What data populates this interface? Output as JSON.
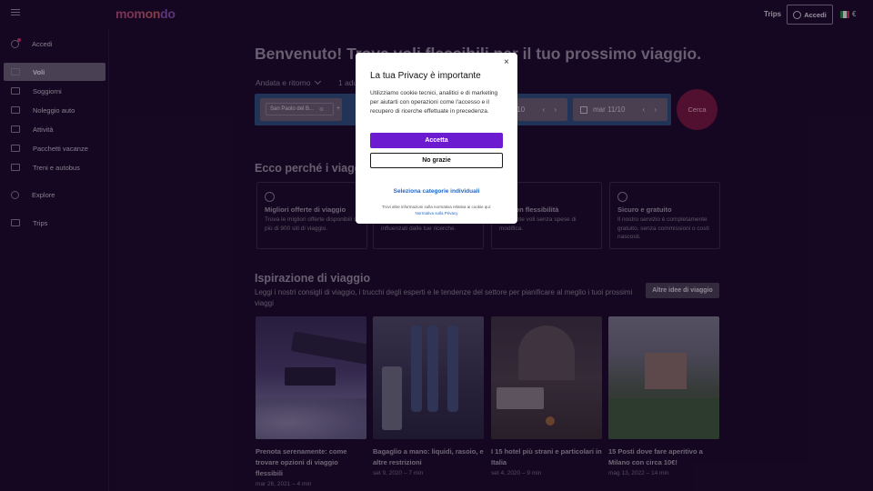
{
  "header": {
    "logo": "momondo",
    "trips_label": "Trips",
    "login_label": "Accedi",
    "currency": "€",
    "flag_colors": [
      "#2a8a4a",
      "#f2f2f2",
      "#c8343e"
    ]
  },
  "sidebar": {
    "items": [
      {
        "label": "Accedi",
        "icon": "user-icon"
      },
      {
        "label": "Voli",
        "icon": "plane-icon",
        "active": true
      },
      {
        "label": "Soggiorni",
        "icon": "bed-icon"
      },
      {
        "label": "Noleggio auto",
        "icon": "car-icon"
      },
      {
        "label": "Attività",
        "icon": "ticket-icon"
      },
      {
        "label": "Pacchetti vacanze",
        "icon": "suitcase-icon"
      },
      {
        "label": "Treni e autobus",
        "icon": "train-icon"
      },
      {
        "label": "Explore",
        "icon": "globe-icon"
      },
      {
        "label": "Trips",
        "icon": "trips-icon"
      }
    ]
  },
  "hero": {
    "title": "Benvenuto! Trova voli flessibili per il tuo prossimo viaggio.",
    "trip_type": "Andata e ritorno",
    "travelers": "1 adu"
  },
  "search": {
    "origin": "San Paolo del B...",
    "origin_remove": "⊗",
    "add": "+",
    "date_depart": "/10",
    "date_return": "mar 11/10",
    "arrows": "‹ ›",
    "button": "Cerca"
  },
  "why": {
    "title": "Ecco perché i viagg",
    "features": [
      {
        "icon": "tag-icon",
        "title": "Migliori offerte di viaggio",
        "text": "Trova le migliori offerte disponibili su più di 900 siti di viaggio."
      },
      {
        "icon": "search-icon",
        "title": "",
        "text": "influenzati dalle tue ricerche."
      },
      {
        "icon": "calendar-icon",
        "title": "ota con flessibilità",
        "text": "acilmente voli senza spese di modifica."
      },
      {
        "icon": "shield-icon",
        "title": "Sicuro e gratuito",
        "text": "Il nostro servizio è completamente gratuito, senza commissioni o costi nascosti."
      }
    ]
  },
  "inspiration": {
    "title": "Ispirazione di viaggio",
    "subtitle": "Leggi i nostri consigli di viaggio, i trucchi degli esperti e le tendenze del settore per pianificare al meglio i tuoi prossimi viaggi",
    "more_button": "Altre idee di viaggio",
    "cards": [
      {
        "title": "Prenota serenamente: come trovare opzioni di viaggio flessibili",
        "date": "mar 26, 2021 – 4 min"
      },
      {
        "title": "Bagaglio a mano: liquidi, rasoio, e altre restrizioni",
        "date": "set 9, 2020 – 7 min"
      },
      {
        "title": "I 15 hotel più strani e particolari in Italia",
        "date": "set 4, 2020 – 9 min"
      },
      {
        "title": "15 Posti dove fare aperitivo a Milano con circa 10€!",
        "date": "mag 13, 2022 – 14 min"
      }
    ]
  },
  "modal": {
    "close": "×",
    "title": "La tua Privacy è importante",
    "text": "Utilizziamo cookie tecnici, analitici e di marketing per aiutarti con operazioni come l'accesso e il recupero di ricerche effettuate in precedenza.",
    "accept": "Accetta",
    "deny": "No grazie",
    "select": "Seleziona categorie individuali",
    "info": "Trovi altre informazioni sulla normativa relativa ai cookie qui:",
    "info_link": "Normativa sulla Privacy"
  }
}
